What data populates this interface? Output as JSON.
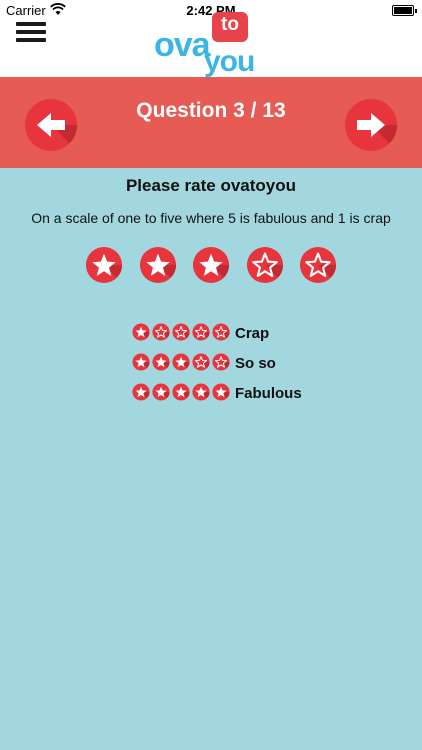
{
  "status_bar": {
    "carrier": "Carrier",
    "time": "2:42 PM"
  },
  "header": {
    "logo": {
      "part1": "ova",
      "part2": "to",
      "part3": "you"
    }
  },
  "question": {
    "counter": "Question 3 / 13",
    "title": "Please rate ovatoyou",
    "subtitle": "On a scale of one to five where 5 is fabulous and 1 is crap",
    "rating": 3,
    "max_rating": 5
  },
  "legend": [
    {
      "filled": 1,
      "label": "Crap"
    },
    {
      "filled": 3,
      "label": "So so"
    },
    {
      "filled": 5,
      "label": "Fabulous"
    }
  ],
  "colors": {
    "accent_red": "#e8343c",
    "bar_red": "#e65b54",
    "content_bg": "#a2d7e0",
    "logo_blue": "#3bb5e6"
  }
}
